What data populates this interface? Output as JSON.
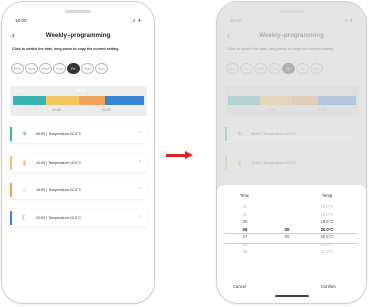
{
  "status": {
    "time": "16:00",
    "icons": ".ıl ✈"
  },
  "header": {
    "back_icon": "‹",
    "title": "Weekly–programming"
  },
  "hint": "Click to switch the date, long press to copy the current setting",
  "days": [
    {
      "label": "Mon",
      "active": false
    },
    {
      "label": "Tues",
      "active": false
    },
    {
      "label": "Wed",
      "active": false
    },
    {
      "label": "Thur",
      "active": false
    },
    {
      "label": "Fri",
      "active": true
    },
    {
      "label": "Sat",
      "active": false
    },
    {
      "label": "Sun",
      "active": false
    }
  ],
  "timeline": {
    "top_ticks": [
      "06:00",
      "18:00"
    ],
    "bottom_ticks": [
      "12:00",
      "22:00"
    ],
    "segments": [
      {
        "color": "#3ab3b0",
        "share": 0.25
      },
      {
        "color": "#f2c65f",
        "share": 0.25
      },
      {
        "color": "#f0a15a",
        "share": 0.2
      },
      {
        "color": "#3a86d6",
        "share": 0.3
      }
    ]
  },
  "schedule": [
    {
      "time": "06:00",
      "label": "Temperature:20.0°C",
      "icon": "sun-icon",
      "glyph": "☀",
      "color": "#3ab3b0"
    },
    {
      "time": "12:00",
      "label": "Temperature:15.0°C",
      "icon": "door-icon",
      "glyph": "▮",
      "color": "#f2c65f"
    },
    {
      "time": "18:00",
      "label": "Temperature:22.0°C",
      "icon": "home-icon",
      "glyph": "⌂",
      "color": "#f0a15a"
    },
    {
      "time": "22:00",
      "label": "Temperature:15.0°C",
      "icon": "moon-icon",
      "glyph": "☾",
      "color": "#3a86d6"
    }
  ],
  "picker": {
    "time_header": "Time",
    "temp_header": "Temp",
    "hours": [
      "03",
      "04",
      "05",
      "06",
      "07",
      "08",
      "09"
    ],
    "minutes": [
      "",
      "",
      "",
      "00",
      "00",
      "",
      ""
    ],
    "temps": [
      "18.0°C",
      "19.0°C",
      "19.5°C",
      "20.0°C",
      "20.5°C",
      "21.0°C",
      "21.5°C"
    ],
    "cancel": "Cancel",
    "confirm": "Confirm"
  },
  "arrow_color": "#e02424"
}
